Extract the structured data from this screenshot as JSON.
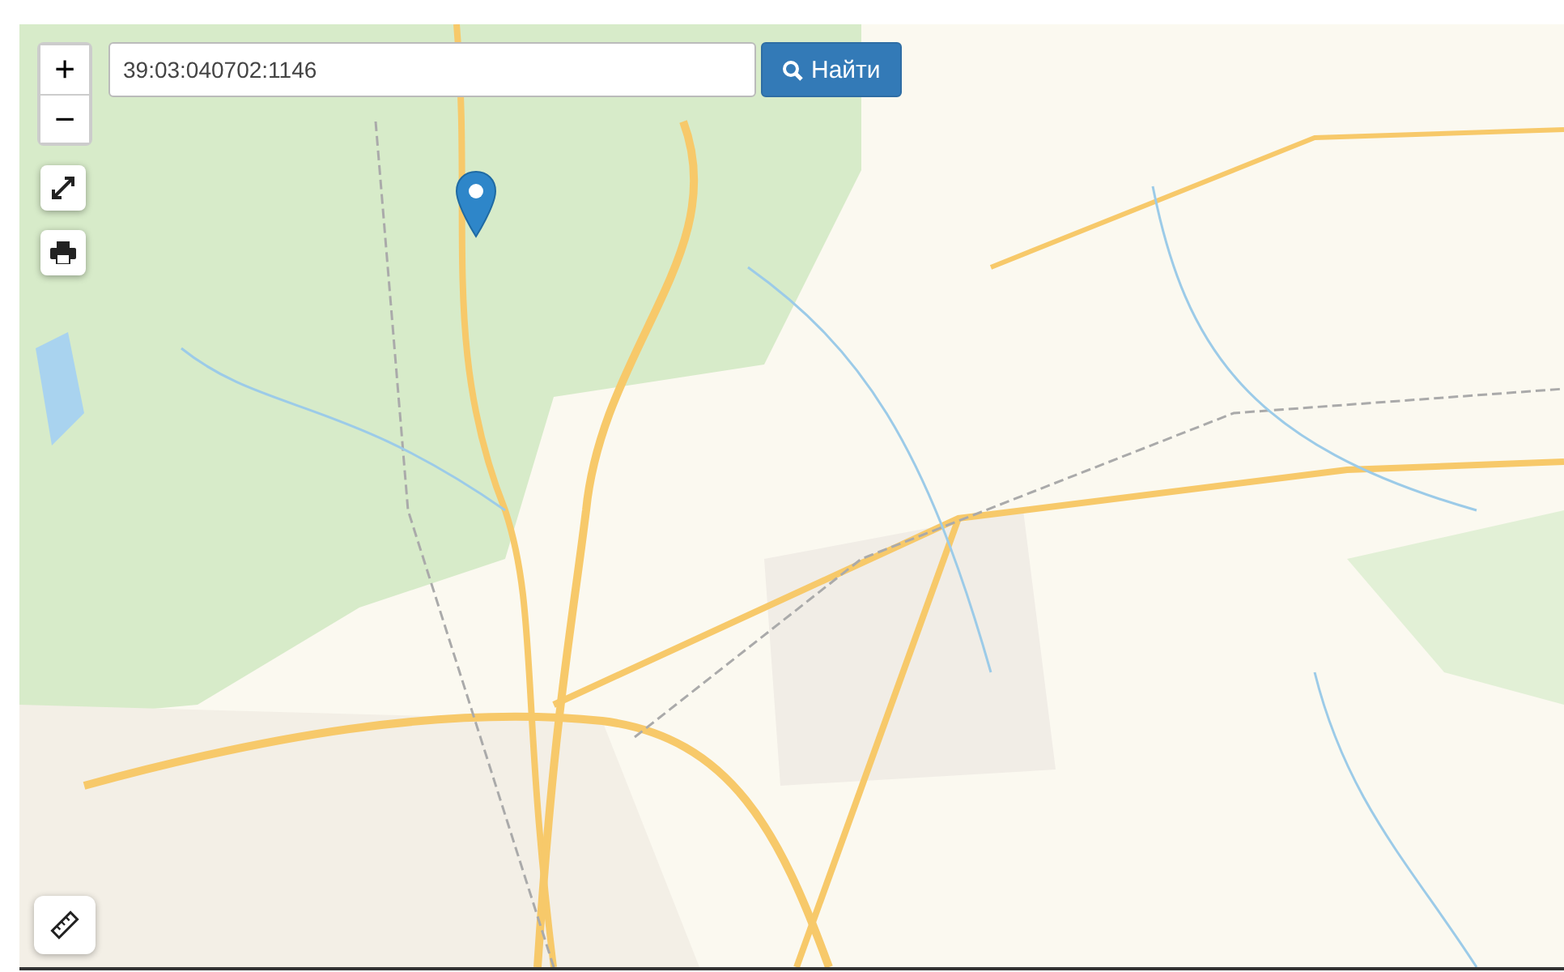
{
  "search": {
    "value": "39:03:040702:1146"
  },
  "search_button": {
    "label": "Найти"
  },
  "zoom_controls": [
    {
      "label": "+"
    },
    {
      "label": "−"
    }
  ]
}
